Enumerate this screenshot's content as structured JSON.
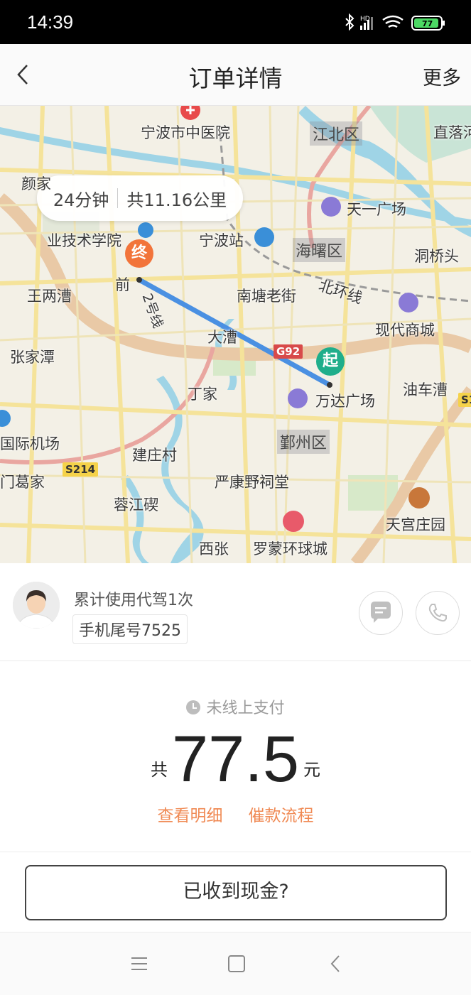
{
  "status_bar": {
    "time": "14:39",
    "battery": "77",
    "network": "HD"
  },
  "nav": {
    "title": "订单详情",
    "more": "更多"
  },
  "map": {
    "route_duration": "24分钟",
    "route_distance": "共11.16公里",
    "marker_start": "起",
    "marker_end": "终",
    "labels": {
      "hospital": "宁波市中医院",
      "jiangbei": "江北区",
      "zhiluo": "直落河",
      "yan": "颜家",
      "tianyi": "天一广场",
      "college": "业技术学院",
      "station": "宁波站",
      "haishu": "海曙区",
      "dongqiaotou": "洞桥头",
      "qian": "前",
      "wangliang": "王两漕",
      "nantang": "南塘老街",
      "beihuan": "北环线",
      "line2": "2号线",
      "modern_mall": "现代商城",
      "dali": "大漕",
      "zhangjia": "张家潭",
      "g92": "G92",
      "youcheqi": "油车漕",
      "dingjia": "丁家",
      "wanda": "万达广场",
      "airport": "国际机场",
      "yinzhou": "鄞州区",
      "jianzhuang": "建庄村",
      "gejia": "门葛家",
      "s214": "S214",
      "yankang": "严康野祠堂",
      "rongjiang": "蓉江碶",
      "tiangong": "天宫庄园",
      "xizhang": "西张",
      "luomeng": "罗蒙环球城",
      "s1": "S1"
    }
  },
  "driver": {
    "usage": "累计使用代驾1次",
    "phone_tail": "手机尾号7525",
    "icons": {
      "chat": "chat-icon",
      "call": "phone-icon"
    }
  },
  "payment": {
    "status": "未线上支付",
    "prefix": "共",
    "amount": "77.5",
    "unit": "元",
    "detail_link": "查看明细",
    "collect_link": "催款流程"
  },
  "cash_button": "已收到现金?",
  "colors": {
    "accent": "#f08a54",
    "start_marker": "#1fae8b",
    "end_marker": "#f2743a",
    "route": "#4a90e2"
  }
}
